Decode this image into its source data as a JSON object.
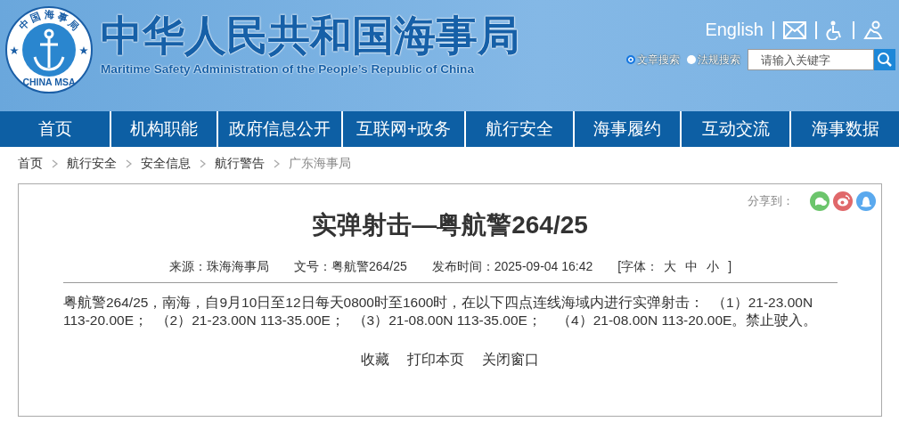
{
  "logo": {
    "top_text": "中 国 海 事 局",
    "bottom_text": "CHINA MSA"
  },
  "site": {
    "title": "中华人民共和国海事局",
    "subtitle": "Maritime Safety Administration of the People’s Republic of China"
  },
  "top_links": {
    "language": "English"
  },
  "search": {
    "options": [
      {
        "label": "文章搜索",
        "selected": true
      },
      {
        "label": "法规搜索",
        "selected": false
      }
    ],
    "placeholder": "请输入关键字"
  },
  "nav": {
    "items": [
      {
        "label": "首页",
        "selected": false
      },
      {
        "label": "机构职能",
        "selected": false
      },
      {
        "label": "政府信息公开",
        "selected": false
      },
      {
        "label": "互联网+政务",
        "selected": false
      },
      {
        "label": "航行安全",
        "selected": false
      },
      {
        "label": "海事履约",
        "selected": false
      },
      {
        "label": "互动交流",
        "selected": false
      },
      {
        "label": "海事数据",
        "selected": false
      }
    ]
  },
  "breadcrumb": [
    "首页",
    "航行安全",
    "安全信息",
    "航行警告",
    "广东海事局"
  ],
  "article": {
    "share_label": "分享到：",
    "share": [
      {
        "kind": "chat",
        "color": "#6cc56c"
      },
      {
        "kind": "eye",
        "color": "#e0686a"
      },
      {
        "kind": "bell",
        "color": "#5aa9ee"
      }
    ],
    "title": "实弹射击—粤航警264/25",
    "meta": {
      "source": "来源：珠海海事局",
      "number": "文号：粤航警264/25",
      "time": "发布时间：2025-09-04 16:42",
      "font_label": "[字体：",
      "font_sizes": [
        "大",
        "中",
        "小"
      ],
      "font_close": "]"
    },
    "body": "粤航警264/25，南海，自9月10日至12日每天0800时至1600时，在以下四点连线海域内进行实弹射击：  （1）21-23.00N 113-20.00E；  （2）21-23.00N 113-35.00E；  （3）21-08.00N 113-35.00E；    （4）21-08.00N 113-20.00E。禁止驶入。",
    "actions": [
      "收藏",
      "打印本页",
      "关闭窗口"
    ]
  }
}
